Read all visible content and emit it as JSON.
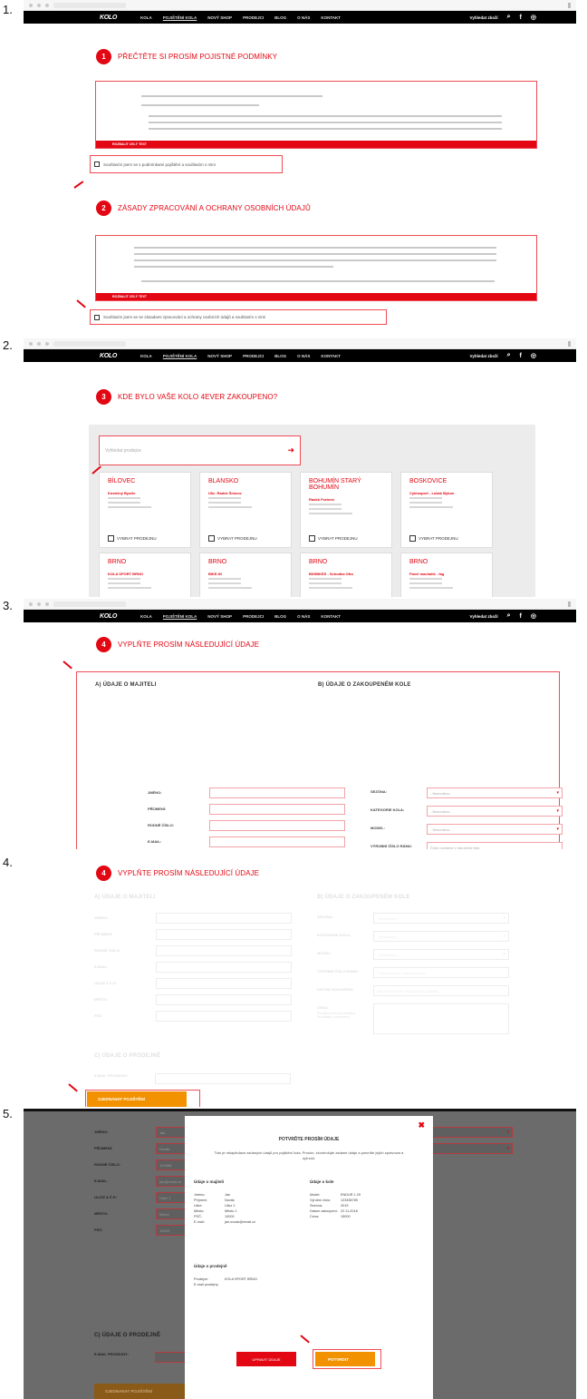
{
  "steps": [
    "1.",
    "2.",
    "3.",
    "4.",
    "5."
  ],
  "nav": {
    "logo": "KOLO",
    "items": [
      "KOLA",
      "POJIŠTĚNÍ KOLA",
      "NOVÝ SHOP",
      "PRODEJCI",
      "BLOG",
      "O NÁS",
      "KONTAKT"
    ],
    "search_label": "Vyhledat zboží",
    "search_icon": "search-icon",
    "fb_icon": "facebook-icon",
    "account_icon": "account-icon"
  },
  "step1": {
    "badge": "1",
    "title": "PŘEČTĚTE SI PROSÍM POJISTNÉ PODMÍNKY",
    "bar_label": "ROZBALIT CELÝ TEXT",
    "check_label": "Souhlasím jsem se s podmínkami pojištění a souhlasím s nimi",
    "badge2": "2",
    "title2": "ZÁSADY ZPRACOVÁNÍ A OCHRANY OSOBNÍCH ÚDAJŮ",
    "bar_label2": "ROZBALIT CELÝ TEXT",
    "check_label2": "Souhlasím jsem se se zásadami zpracování a ochrany osobních údajů a souhlasím s nimi"
  },
  "step2": {
    "badge": "3",
    "title": "KDE BYLO VAŠE KOLO 4EVER ZAKOUPENO?",
    "search_placeholder": "Vyhledat prodejce",
    "select_label": "VYBRAT PRODEJNU",
    "cards": [
      {
        "city": "BÍLOVEC",
        "shop": "Kostelný Bystře"
      },
      {
        "city": "BLANSKO",
        "shop": "Ulic. Radek Šimvoc"
      },
      {
        "city": "BOHUMÍN STARÝ BOHUMÍN",
        "shop": "Radek Forbest"
      },
      {
        "city": "BOSKOVICE",
        "shop": "Cyklosport - Lukáš Bykon"
      },
      {
        "city": "BRNO",
        "shop": "KOLA SPORT BRNO"
      },
      {
        "city": "BRNO",
        "shop": "BIKE-IN"
      },
      {
        "city": "BRNO",
        "shop": "BIGBIKES - Schodka Otto"
      },
      {
        "city": "BRNO",
        "shop": "Pavel machalík - fag"
      }
    ]
  },
  "step3": {
    "badge": "4",
    "title": "VYPLŇTE PROSÍM NÁSLEDUJÍCÍ ÚDAJE",
    "col_a": "A) ÚDAJE O MAJITELI",
    "col_b": "B) ÚDAJE O ZAKOUPENÉM KOLE",
    "a_labels": [
      "JMÉNO:",
      "PŘÍJMENÍ:",
      "RODNÉ ČÍSLO:",
      "E-MAIL:",
      "ULICE A Č.P.:",
      "MĚSTO:",
      "PSČ:"
    ],
    "b_labels": [
      "SEZÓNA:",
      "KATEGORIE KOLA:",
      "MODEL:",
      "VÝROBNÍ ČÍSLO RÁMU:",
      "DATUM ZAKOUPENÍ:",
      "CENA:"
    ],
    "cena_note": "(Prodejní cena kola uvedená na dokladu o zakoupení)",
    "select_placeholder": "- Nezvoleno -",
    "serial_placeholder": "Číslo uvedené v záručním listu",
    "date_placeholder": "Datum uvedené na prodejním dokladu"
  },
  "step4": {
    "badge": "4",
    "title": "VYPLŇTE PROSÍM NÁSLEDUJÍCÍ ÚDAJE",
    "col_a": "A) ÚDAJE O MAJITELI",
    "col_b": "B) ÚDAJE O ZAKOUPENÉM KOLE",
    "col_c": "C) ÚDAJE O PRODEJNĚ",
    "c_label": "E-MAIL PRODEJNY:",
    "button": "SJEDNANAT POJIŠTĚNÍ"
  },
  "step5": {
    "a_labels": [
      "JMÉNO:",
      "PŘÍJMENÍ:",
      "RODNÉ ČÍSLO:",
      "E-MAIL:",
      "ULICE A Č.P.:",
      "MĚSTO:",
      "PSČ:"
    ],
    "a_values": [
      "Jan",
      "Novák",
      "123456",
      "jan@email.cz",
      "Ulice 1",
      "Město",
      "10000"
    ],
    "col_c": "C) ÚDAJE O PRODEJNĚ",
    "c_label": "E-MAIL PRODEJNY:",
    "button_bg": "SJEDNANAT POJIŠTĚNÍ",
    "modal": {
      "title": "POTVRĎTE PROSÍM ÚDAJE",
      "text": "Toto je rekapitulace zadaných údajů pro pojištění kola. Prosím, zkontrolujte zadané údaje a potvrďte jejich správnost a úplnost.",
      "owner_head": "Údaje o majiteli",
      "owner_rows": [
        {
          "k": "Jméno:",
          "v": "Jan"
        },
        {
          "k": "Příjmení:",
          "v": "Novák"
        },
        {
          "k": "Ulice:",
          "v": "Ulice 1"
        },
        {
          "k": "Město:",
          "v": "Město 1"
        },
        {
          "k": "PSČ:",
          "v": "10000"
        },
        {
          "k": "E-mail:",
          "v": "jan.novak@email.cz"
        }
      ],
      "bike_head": "Údaje o kole",
      "bike_rows": [
        {
          "k": "Model:",
          "v": "ENDUR 1.29"
        },
        {
          "k": "Výrobní číslo:",
          "v": "123456789"
        },
        {
          "k": "Sezóna:",
          "v": "2019"
        },
        {
          "k": "Datum zakoupení:",
          "v": "22.11.2018"
        },
        {
          "k": "Cena:",
          "v": "15000"
        }
      ],
      "shop_head": "Údaje o prodejně",
      "shop_rows": [
        {
          "k": "Prodejce:",
          "v": "KOLA SPORT BRNO"
        },
        {
          "k": "E-mail prodejny:",
          "v": ""
        }
      ],
      "back_button": "UPRAVIT ÚDAJE",
      "confirm_button": "POTVRDIT",
      "close_icon": "close-icon"
    }
  }
}
